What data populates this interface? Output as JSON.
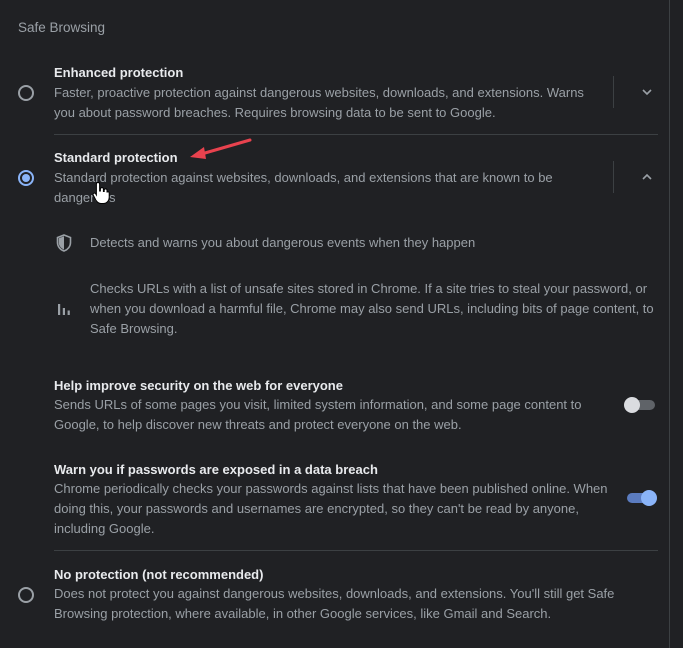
{
  "section": {
    "title": "Safe Browsing"
  },
  "options": {
    "enhanced": {
      "title": "Enhanced protection",
      "desc_line1": "Faster, proactive protection against dangerous websites, downloads, and extensions. Warns",
      "desc_line2": "you about password breaches. Requires browsing data to be sent to Google.",
      "selected": false,
      "expanded": false,
      "expand_icon": "chevron-down-icon"
    },
    "standard": {
      "title": "Standard protection",
      "desc_line1": "Standard protection against websites, downloads, and extensions that are known to be",
      "desc_line2": "dangerous",
      "selected": true,
      "expanded": true,
      "expand_icon": "chevron-up-icon",
      "features": [
        {
          "icon": "shield-icon",
          "text": "Detects and warns you about dangerous events when they happen"
        },
        {
          "icon": "bar-chart-icon",
          "line1": "Checks URLs with a list of unsafe sites stored in Chrome. If a site tries to steal your password, or",
          "line2": "when you download a harmful file, Chrome may also send URLs, including bits of page content, to",
          "line3": "Safe Browsing."
        }
      ],
      "toggles": [
        {
          "title": "Help improve security on the web for everyone",
          "line1": "Sends URLs of some pages you visit, limited system information, and some page content to",
          "line2": "Google, to help discover new threats and protect everyone on the web.",
          "on": false
        },
        {
          "title": "Warn you if passwords are exposed in a data breach",
          "line1": "Chrome periodically checks your passwords against lists that have been published online. When",
          "line2": "doing this, your passwords and usernames are encrypted, so they can't be read by anyone,",
          "line3": "including Google.",
          "on": true
        }
      ]
    },
    "none": {
      "title": "No protection (not recommended)",
      "desc_line1": "Does not protect you against dangerous websites, downloads, and extensions. You'll still get Safe",
      "desc_line2": "Browsing protection, where available, in other Google services, like Gmail and Search.",
      "selected": false
    }
  },
  "colors": {
    "background": "#202124",
    "accent": "#8ab4f8",
    "annotation_arrow": "#e8424e"
  }
}
